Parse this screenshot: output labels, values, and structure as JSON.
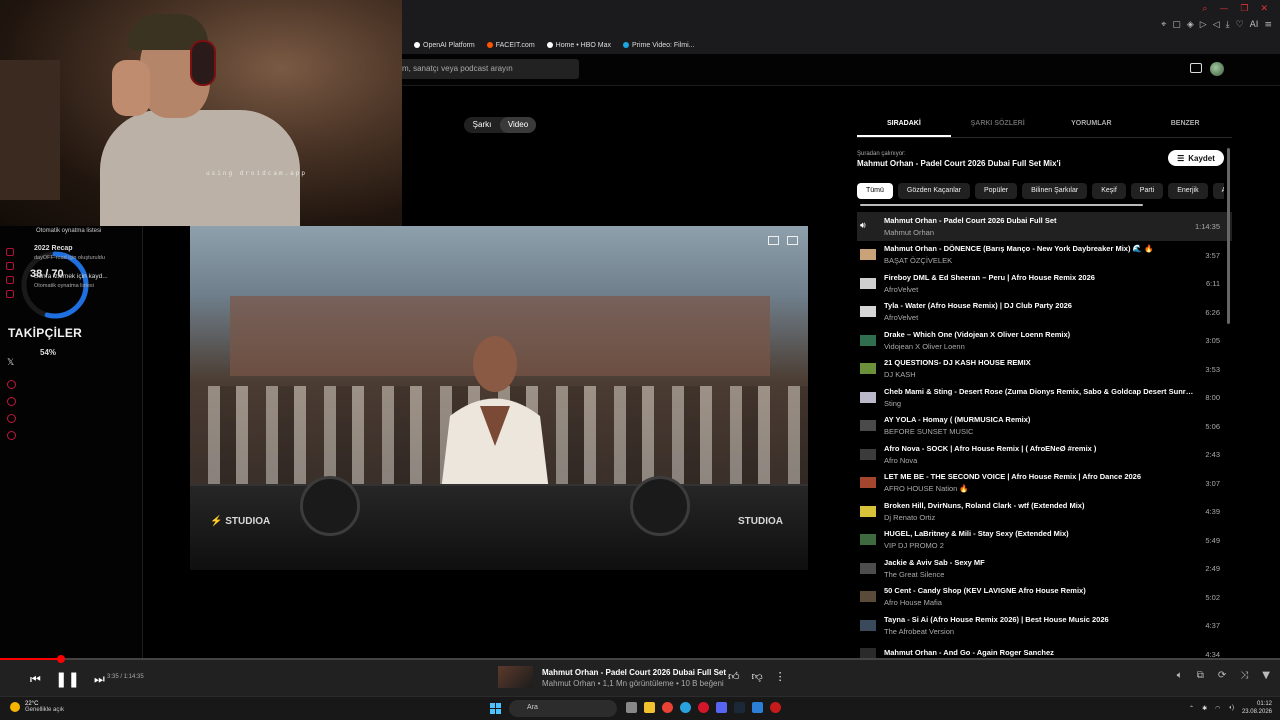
{
  "browser": {
    "bookmarks": [
      {
        "label": "OpenAI Platform",
        "color": "#ffffff"
      },
      {
        "label": "FACEIT.com",
        "color": "#ff5500"
      },
      {
        "label": "Home • HBO Max",
        "color": "#ffffff"
      },
      {
        "label": "Prime Video: Filmi...",
        "color": "#1aa7e1"
      }
    ],
    "ai_label": "AI"
  },
  "header": {
    "search_placeholder": "m, sanatçı veya podcast arayın"
  },
  "toggle": {
    "song": "Şarkı",
    "video": "Video"
  },
  "webcam": {
    "watermark": "using droidcam.app"
  },
  "overlay": {
    "auto_playlist": "Otomatik oynatma listesi",
    "recap_title": "2022 Recap",
    "recap_sub": "dayOFF-road için oluşturuldu",
    "saved_line": "Sonra izlemek için kayd...",
    "auto_playlist2": "Otomatik oynatma listesi",
    "counter": "38 / 70",
    "progress": 0.54,
    "followers_label": "TAKİPÇİLER",
    "followers_pct": "54%"
  },
  "queue": {
    "tabs": [
      "SIRADAKİ",
      "ŞARKI SÖZLERİ",
      "YORUMLAR",
      "BENZER"
    ],
    "playing_from_label": "Şuradan çalınıyor:",
    "source": "Mahmut Orhan - Padel Court 2026 Dubai Full Set Mix'i",
    "save_label": "Kaydet",
    "chips": [
      "Tümü",
      "Gözden Kaçanlar",
      "Popüler",
      "Bilinen Şarkılar",
      "Keşif",
      "Parti",
      "Enerjik",
      "Antrenman"
    ],
    "tracks": [
      {
        "title": "Mahmut Orhan - Padel Court 2026 Dubai Full Set",
        "artist": "Mahmut Orhan",
        "duration": "1:14:35",
        "thumb": "#3a3a3a"
      },
      {
        "title": "Mahmut Orhan - DÖNENCE (Barış Manço - New York Daybreaker Mix) 🌊 🔥",
        "artist": "BAŞAT ÖZÇİVELEK",
        "duration": "3:57",
        "thumb": "#c9a27a"
      },
      {
        "title": "Fireboy DML & Ed Sheeran – Peru | Afro House Remix 2026",
        "artist": "AfroVelvet",
        "duration": "6:11",
        "thumb": "#cfcfcf"
      },
      {
        "title": "Tyla - Water (Afro House Remix) | DJ Club Party 2026",
        "artist": "AfroVelvet",
        "duration": "6:26",
        "thumb": "#d6d6d6"
      },
      {
        "title": "Drake – Which One (Vidojean X Oliver Loenn Remix)",
        "artist": "Vidojean X Oliver Loenn",
        "duration": "3:05",
        "thumb": "#2f6e4f"
      },
      {
        "title": "21 QUESTIONS- DJ KASH HOUSE REMIX",
        "artist": "DJ KASH",
        "duration": "3:53",
        "thumb": "#6b8f3a"
      },
      {
        "title": "Cheb Mami & Sting - Desert Rose (Zuma Dionys Remix, Sabo & Goldcap Desert Sunri...",
        "artist": "Sting",
        "duration": "8:00",
        "thumb": "#b9b9c9"
      },
      {
        "title": "AY YOLA - Homay ( (MURMUSICA Remix)",
        "artist": "BEFORE SUNSET MUSIC",
        "duration": "5:06",
        "thumb": "#4a4a4a"
      },
      {
        "title": "Afro Nova - SOCK | Afro House Remix | ( AfroENeØ #remix )",
        "artist": "Afro Nova",
        "duration": "2:43",
        "thumb": "#3b3b3b"
      },
      {
        "title": "LET ME BE - THE SECOND VOICE | Afro House Remix | Afro Dance 2026",
        "artist": "AFRO HOUSE Nation 🔥",
        "duration": "3:07",
        "thumb": "#a4462e"
      },
      {
        "title": "Broken Hill, DvirNuns, Roland Clark - wtf (Extended Mix)",
        "artist": "Dj Renato Ortiz",
        "duration": "4:39",
        "thumb": "#d8c23a"
      },
      {
        "title": "HUGEL, LaBritney & Mili - Stay Sexy (Extended Mix)",
        "artist": "VIP DJ PROMO 2",
        "duration": "5:49",
        "thumb": "#3f6a3f"
      },
      {
        "title": "Jackie & Aviv Sab - Sexy MF",
        "artist": "The Great Silence",
        "duration": "2:49",
        "thumb": "#4d4d4d"
      },
      {
        "title": "50 Cent - Candy Shop (KEV LAVIGNE Afro House Remix)",
        "artist": "Afro House Mafia",
        "duration": "5:02",
        "thumb": "#5a4a3a"
      },
      {
        "title": "Tayna - Si Ai (Afro House Remix 2026) | Best House Music 2026",
        "artist": "The Afrobeat Version",
        "duration": "4:37",
        "thumb": "#3a4a5a"
      },
      {
        "title": "Mahmut Orhan - And Go - Again Roger Sanchez",
        "artist": "",
        "duration": "4:34",
        "thumb": "#2a2a2a"
      }
    ]
  },
  "player": {
    "time": "3:35 / 1:14:35",
    "progress": 0.048,
    "title": "Mahmut Orhan - Padel Court 2026 Dubai Full Set",
    "subtitle": "Mahmut Orhan • 1,1 Mn görüntüleme • 10 B beğeni"
  },
  "taskbar": {
    "temp": "22°C",
    "weather": "Genellikle açık",
    "search": "Ara",
    "time": "01:12",
    "date": "23.08.2026"
  },
  "colors": {
    "accent": "#ff0000",
    "brand_red": "#c0163e",
    "ring": "#1e6fe0"
  }
}
